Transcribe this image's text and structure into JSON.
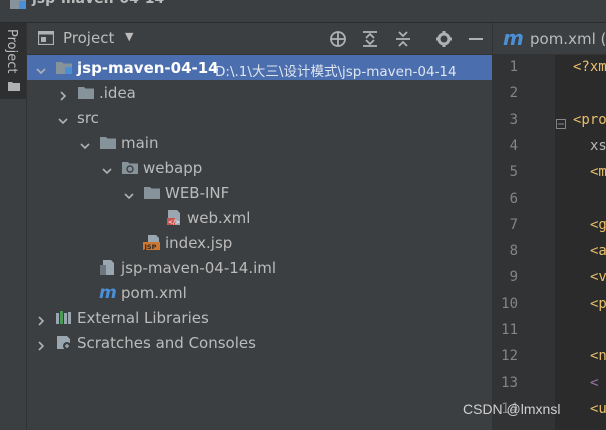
{
  "window": {
    "title": "jsp-maven-04-14"
  },
  "tool_strip": {
    "project_tab_label": "Project",
    "folder_icon": "folder-icon"
  },
  "project_panel": {
    "header_title": "Project",
    "header_caret": "▼",
    "toolbar_icons": [
      "locate-icon",
      "expand-all-icon",
      "collapse-all-icon",
      "gear-icon",
      "minimize-icon"
    ],
    "tree": [
      {
        "label": "jsp-maven-04-14",
        "path": "D:\\.1\\大三\\设计模式\\jsp-maven-04-14",
        "icon": "module-folder-icon",
        "arrow": "expanded",
        "depth": 0,
        "selected": true,
        "bold": true
      },
      {
        "label": ".idea",
        "icon": "folder-icon",
        "arrow": "collapsed",
        "depth": 1
      },
      {
        "label": "src",
        "icon": "",
        "arrow": "expanded",
        "depth": 1
      },
      {
        "label": "main",
        "icon": "folder-icon",
        "arrow": "expanded",
        "depth": 2
      },
      {
        "label": "webapp",
        "icon": "web-folder-icon",
        "arrow": "expanded",
        "depth": 3
      },
      {
        "label": "WEB-INF",
        "icon": "folder-icon",
        "arrow": "expanded",
        "depth": 4
      },
      {
        "label": "web.xml",
        "icon": "xml-config-icon",
        "arrow": "none",
        "depth": 5
      },
      {
        "label": "index.jsp",
        "icon": "jsp-file-icon",
        "arrow": "none",
        "depth": 4
      },
      {
        "label": "jsp-maven-04-14.iml",
        "icon": "iml-file-icon",
        "arrow": "none",
        "depth": 2
      },
      {
        "label": "pom.xml",
        "icon": "maven-icon",
        "arrow": "none",
        "depth": 2
      },
      {
        "label": "External Libraries",
        "icon": "libraries-icon",
        "arrow": "collapsed",
        "depth": 0
      },
      {
        "label": "Scratches and Consoles",
        "icon": "scratches-icon",
        "arrow": "collapsed",
        "depth": 0
      }
    ]
  },
  "editor": {
    "tab_letter": "m",
    "tab_name": "pom.xml (j",
    "line_numbers": [
      "1",
      "2",
      "3",
      "4",
      "5",
      "6",
      "7",
      "8",
      "9",
      "10",
      "11",
      "12",
      "13",
      "14"
    ],
    "code_lines": [
      {
        "text": "<?xm",
        "cls": "tagc",
        "indent": 0
      },
      {
        "text": "",
        "cls": "",
        "indent": 0
      },
      {
        "text": "<pro",
        "cls": "tagc",
        "indent": 0,
        "fold": true
      },
      {
        "text": "xs",
        "cls": "attrc",
        "indent": 1
      },
      {
        "text": "<m",
        "cls": "tagc",
        "indent": 1
      },
      {
        "text": "",
        "cls": "",
        "indent": 0
      },
      {
        "text": "<g",
        "cls": "tagc",
        "indent": 1
      },
      {
        "text": "<a",
        "cls": "tagc",
        "indent": 1
      },
      {
        "text": "<v",
        "cls": "tagc",
        "indent": 1
      },
      {
        "text": "<p",
        "cls": "tagc",
        "indent": 1
      },
      {
        "text": "",
        "cls": "",
        "indent": 0
      },
      {
        "text": "<n",
        "cls": "tagc",
        "indent": 1
      },
      {
        "text": "<",
        "cls": "blue",
        "indent": 1
      },
      {
        "text": "<u",
        "cls": "tagc",
        "indent": 1
      }
    ]
  },
  "watermark": "CSDN @lmxnsl",
  "colors": {
    "selection": "#4b6eaf",
    "panel_bg": "#3c3f41",
    "editor_bg": "#2b2b2b",
    "folder": "#87939a",
    "maven_blue": "#4b8fd6",
    "jsp_orange": "#cc7832"
  }
}
